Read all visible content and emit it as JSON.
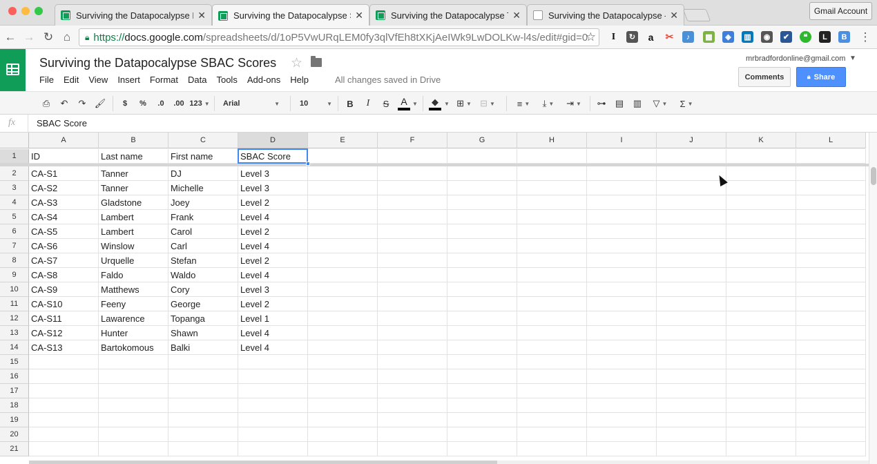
{
  "browser": {
    "tabs": [
      {
        "title": "Surviving the Datapocalypse F",
        "icon": "sheets-icon"
      },
      {
        "title": "Surviving the Datapocalypse S",
        "icon": "sheets-icon"
      },
      {
        "title": "Surviving the Datapocalypse T",
        "icon": "sheets-icon"
      },
      {
        "title": "Surviving the Datapocalypse –",
        "icon": "doc-icon"
      }
    ],
    "active_tab": 1,
    "profile_button": "Gmail Account",
    "url": {
      "scheme": "https://",
      "host": "docs.google.com",
      "path": "/spreadsheets/d/1oP5VwURqLEM0fy3qlVfEh8tXKjAeIWk9LwDOLKw-l4s/edit#gid=0"
    }
  },
  "doc": {
    "title": "Surviving the Datapocalypse SBAC Scores",
    "menu": [
      "File",
      "Edit",
      "View",
      "Insert",
      "Format",
      "Data",
      "Tools",
      "Add-ons",
      "Help"
    ],
    "saved_status": "All changes saved in Drive",
    "account_email": "mrbradfordonline@gmail.com",
    "comments_label": "Comments",
    "share_label": "Share"
  },
  "toolbar": {
    "currency": "$",
    "percent": "%",
    "dec_decrease": ".0",
    "dec_increase": ".00",
    "more_formats": "123",
    "font": "Arial",
    "font_size": "10",
    "bold": "B",
    "italic": "I",
    "strike": "S",
    "text_color": "A",
    "sigma": "Σ"
  },
  "formula_bar": {
    "fx": "fx",
    "value": "SBAC Score"
  },
  "sheet": {
    "columns": [
      "A",
      "B",
      "C",
      "D",
      "E",
      "F",
      "G",
      "H",
      "I",
      "J",
      "K",
      "L"
    ],
    "selected_column": "D",
    "selected_row": 1,
    "row_numbers": [
      1,
      2,
      3,
      4,
      5,
      6,
      7,
      8,
      9,
      10,
      11,
      12,
      13,
      14,
      15,
      16,
      17,
      18,
      19,
      20,
      21
    ],
    "rows": [
      [
        "ID",
        "Last name",
        "First name",
        "SBAC Score"
      ],
      [
        "CA-S1",
        "Tanner",
        "DJ",
        "Level 3"
      ],
      [
        "CA-S2",
        "Tanner",
        "Michelle",
        "Level 3"
      ],
      [
        "CA-S3",
        "Gladstone",
        "Joey",
        "Level 2"
      ],
      [
        "CA-S4",
        "Lambert",
        "Frank",
        "Level 4"
      ],
      [
        "CA-S5",
        "Lambert",
        "Carol",
        "Level 2"
      ],
      [
        "CA-S6",
        "Winslow",
        "Carl",
        "Level 4"
      ],
      [
        "CA-S7",
        "Urquelle",
        "Stefan",
        "Level 2"
      ],
      [
        "CA-S8",
        "Faldo",
        "Waldo",
        "Level 4"
      ],
      [
        "CA-S9",
        "Matthews",
        "Cory",
        "Level 3"
      ],
      [
        "CA-S10",
        "Feeny",
        "George",
        "Level 2"
      ],
      [
        "CA-S11",
        "Lawarence",
        "Topanga",
        "Level 1"
      ],
      [
        "CA-S12",
        "Hunter",
        "Shawn",
        "Level 4"
      ],
      [
        "CA-S13",
        "Bartokomous",
        "Balki",
        "Level 4"
      ]
    ]
  }
}
